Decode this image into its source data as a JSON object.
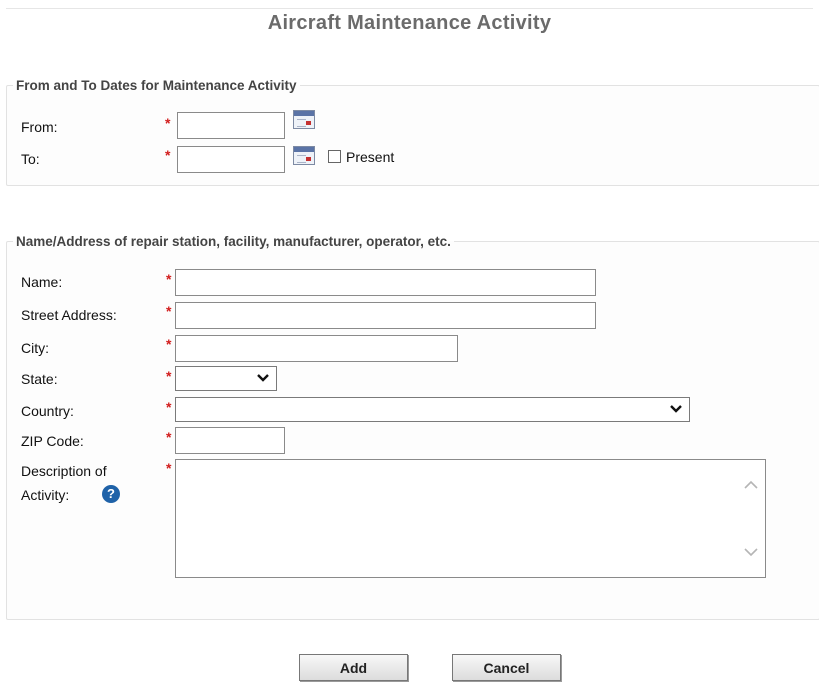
{
  "page": {
    "title": "Aircraft Maintenance Activity"
  },
  "dates_section": {
    "legend": "From and To Dates for Maintenance Activity",
    "from_label": "From:",
    "to_label": "To:",
    "from_value": "",
    "to_value": "",
    "present_label": "Present",
    "present_checked": false,
    "required_mark": "*"
  },
  "address_section": {
    "legend": "Name/Address of repair station, facility, manufacturer, operator, etc.",
    "name_label": "Name:",
    "street_label": "Street Address:",
    "city_label": "City:",
    "state_label": "State:",
    "country_label": "Country:",
    "zip_label": "ZIP Code:",
    "description_label_line1": "Description of",
    "description_label_line2": "Activity:",
    "help_glyph": "?",
    "name_value": "",
    "street_value": "",
    "city_value": "",
    "state_value": "",
    "country_value": "",
    "zip_value": "",
    "description_value": "",
    "required_mark": "*"
  },
  "actions": {
    "add_label": "Add",
    "cancel_label": "Cancel"
  },
  "icons": {
    "calendar": "calendar-icon",
    "help": "help-icon",
    "select_chevron": "chevron-down-icon"
  },
  "colors": {
    "required": "#d21d1d",
    "help": "#1f62a8",
    "title": "#6b6b6b"
  }
}
